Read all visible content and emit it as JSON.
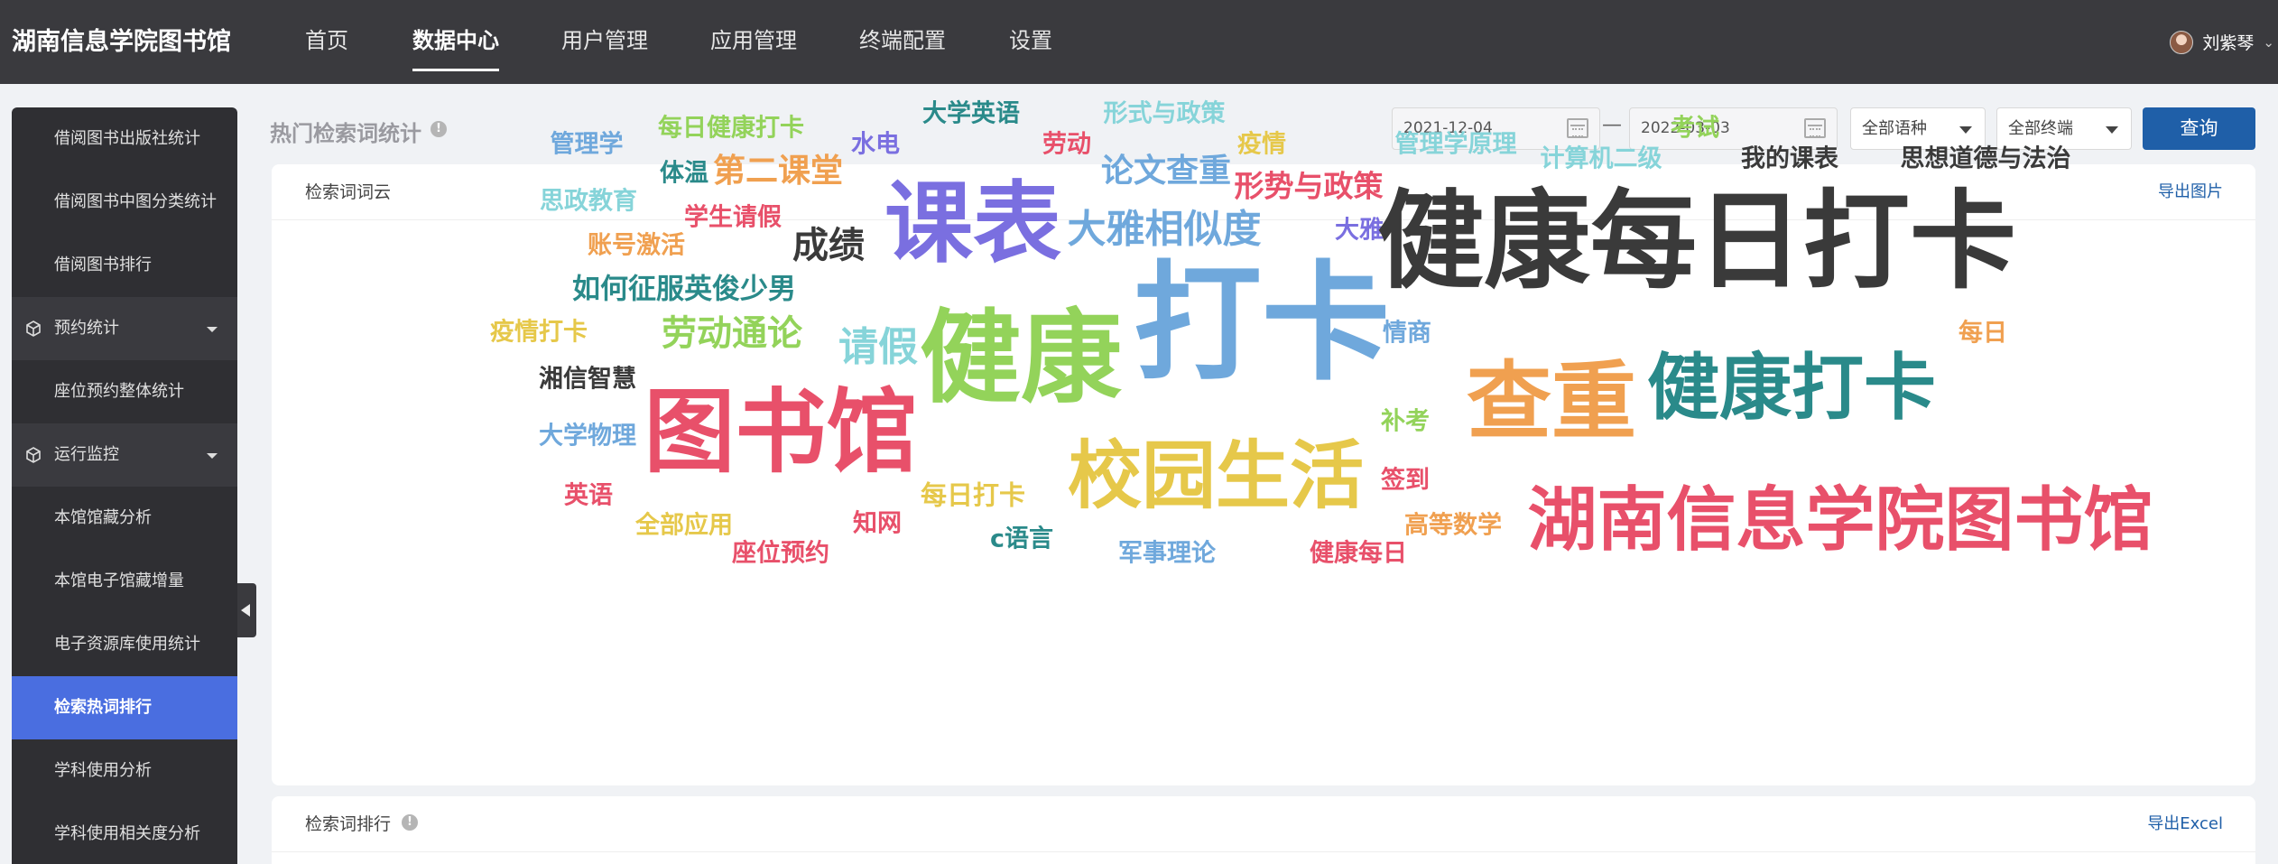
{
  "app": {
    "title": "湖南信息学院图书馆"
  },
  "nav": {
    "items": [
      {
        "label": "首页"
      },
      {
        "label": "数据中心"
      },
      {
        "label": "用户管理"
      },
      {
        "label": "应用管理"
      },
      {
        "label": "终端配置"
      },
      {
        "label": "设置"
      }
    ],
    "active_index": 1
  },
  "user": {
    "name": "刘紫琴"
  },
  "sidebar": {
    "items": [
      {
        "label": "借阅图书出版社统计",
        "type": "sub"
      },
      {
        "label": "借阅图书中图分类统计",
        "type": "sub"
      },
      {
        "label": "借阅图书排行",
        "type": "sub"
      },
      {
        "label": "预约统计",
        "type": "group"
      },
      {
        "label": "座位预约整体统计",
        "type": "sub"
      },
      {
        "label": "运行监控",
        "type": "group"
      },
      {
        "label": "本馆馆藏分析",
        "type": "sub"
      },
      {
        "label": "本馆电子馆藏增量",
        "type": "sub"
      },
      {
        "label": "电子资源库使用统计",
        "type": "sub"
      },
      {
        "label": "检索热词排行",
        "type": "sub",
        "active": true
      },
      {
        "label": "学科使用分析",
        "type": "sub"
      },
      {
        "label": "学科使用相关度分析",
        "type": "sub"
      }
    ]
  },
  "page": {
    "title": "热门检索词统计"
  },
  "filters": {
    "start_date": "2021-12-04",
    "end_date": "2022-03-03",
    "separator": "—",
    "language": "全部语种",
    "terminal": "全部终端",
    "query_label": "查询"
  },
  "cloud_card": {
    "title": "检索词词云",
    "action": "导出图片"
  },
  "ranking_card": {
    "title": "检索词排行",
    "action": "导出Excel"
  },
  "word_cloud": [
    {
      "text": "管理学",
      "color": "#6fa8dc"
    },
    {
      "text": "每日健康打卡",
      "color": "#93d35a"
    },
    {
      "text": "水电",
      "color": "#7a6fe0"
    },
    {
      "text": "大学英语",
      "color": "#2a8a8a"
    },
    {
      "text": "劳动",
      "color": "#e8506a"
    },
    {
      "text": "形式与政策",
      "color": "#86d4d9"
    },
    {
      "text": "疫情",
      "color": "#e6c84a"
    },
    {
      "text": "管理学原理",
      "color": "#86d4d9"
    },
    {
      "text": "考试",
      "color": "#93d35a"
    },
    {
      "text": "计算机二级",
      "color": "#86d4d9"
    },
    {
      "text": "我的课表",
      "color": "#3a3a3a"
    },
    {
      "text": "思想道德与法治",
      "color": "#3a3a3a"
    },
    {
      "text": "体温",
      "color": "#2a8a8a"
    },
    {
      "text": "第二课堂",
      "color": "#f0a050"
    },
    {
      "text": "论文查重",
      "color": "#6fa8dc"
    },
    {
      "text": "形势与政策",
      "color": "#e8506a"
    },
    {
      "text": "思政教育",
      "color": "#86d4d9"
    },
    {
      "text": "学生请假",
      "color": "#e8506a"
    },
    {
      "text": "课表",
      "color": "#7a6fe0"
    },
    {
      "text": "大雅相似度",
      "color": "#6fa8dc"
    },
    {
      "text": "大雅",
      "color": "#7a6fe0"
    },
    {
      "text": "健康每日打卡",
      "color": "#3a3a3a"
    },
    {
      "text": "账号激活",
      "color": "#f0a050"
    },
    {
      "text": "成绩",
      "color": "#3a3a3a"
    },
    {
      "text": "如何征服英俊少男",
      "color": "#2a8a8a"
    },
    {
      "text": "打卡",
      "color": "#6fa8dc"
    },
    {
      "text": "疫情打卡",
      "color": "#e6c84a"
    },
    {
      "text": "劳动通论",
      "color": "#93d35a"
    },
    {
      "text": "请假",
      "color": "#86d4d9"
    },
    {
      "text": "健康",
      "color": "#93d35a"
    },
    {
      "text": "情商",
      "color": "#6fa8dc"
    },
    {
      "text": "每日",
      "color": "#f0a050"
    },
    {
      "text": "湘信智慧",
      "color": "#3a3a3a"
    },
    {
      "text": "查重",
      "color": "#f0a050"
    },
    {
      "text": "健康打卡",
      "color": "#2a8a8a"
    },
    {
      "text": "图书馆",
      "color": "#e8506a"
    },
    {
      "text": "大学物理",
      "color": "#6fa8dc"
    },
    {
      "text": "补考",
      "color": "#93d35a"
    },
    {
      "text": "校园生活",
      "color": "#e6c84a"
    },
    {
      "text": "签到",
      "color": "#e8506a"
    },
    {
      "text": "英语",
      "color": "#e8506a"
    },
    {
      "text": "每日打卡",
      "color": "#e6c84a"
    },
    {
      "text": "高等数学",
      "color": "#f0a050"
    },
    {
      "text": "湖南信息学院图书馆",
      "color": "#e8506a"
    },
    {
      "text": "全部应用",
      "color": "#e6c84a"
    },
    {
      "text": "知网",
      "color": "#e8506a"
    },
    {
      "text": "c语言",
      "color": "#2a8a8a"
    },
    {
      "text": "座位预约",
      "color": "#e8506a"
    },
    {
      "text": "军事理论",
      "color": "#6fa8dc"
    },
    {
      "text": "健康每日",
      "color": "#e8506a"
    }
  ]
}
